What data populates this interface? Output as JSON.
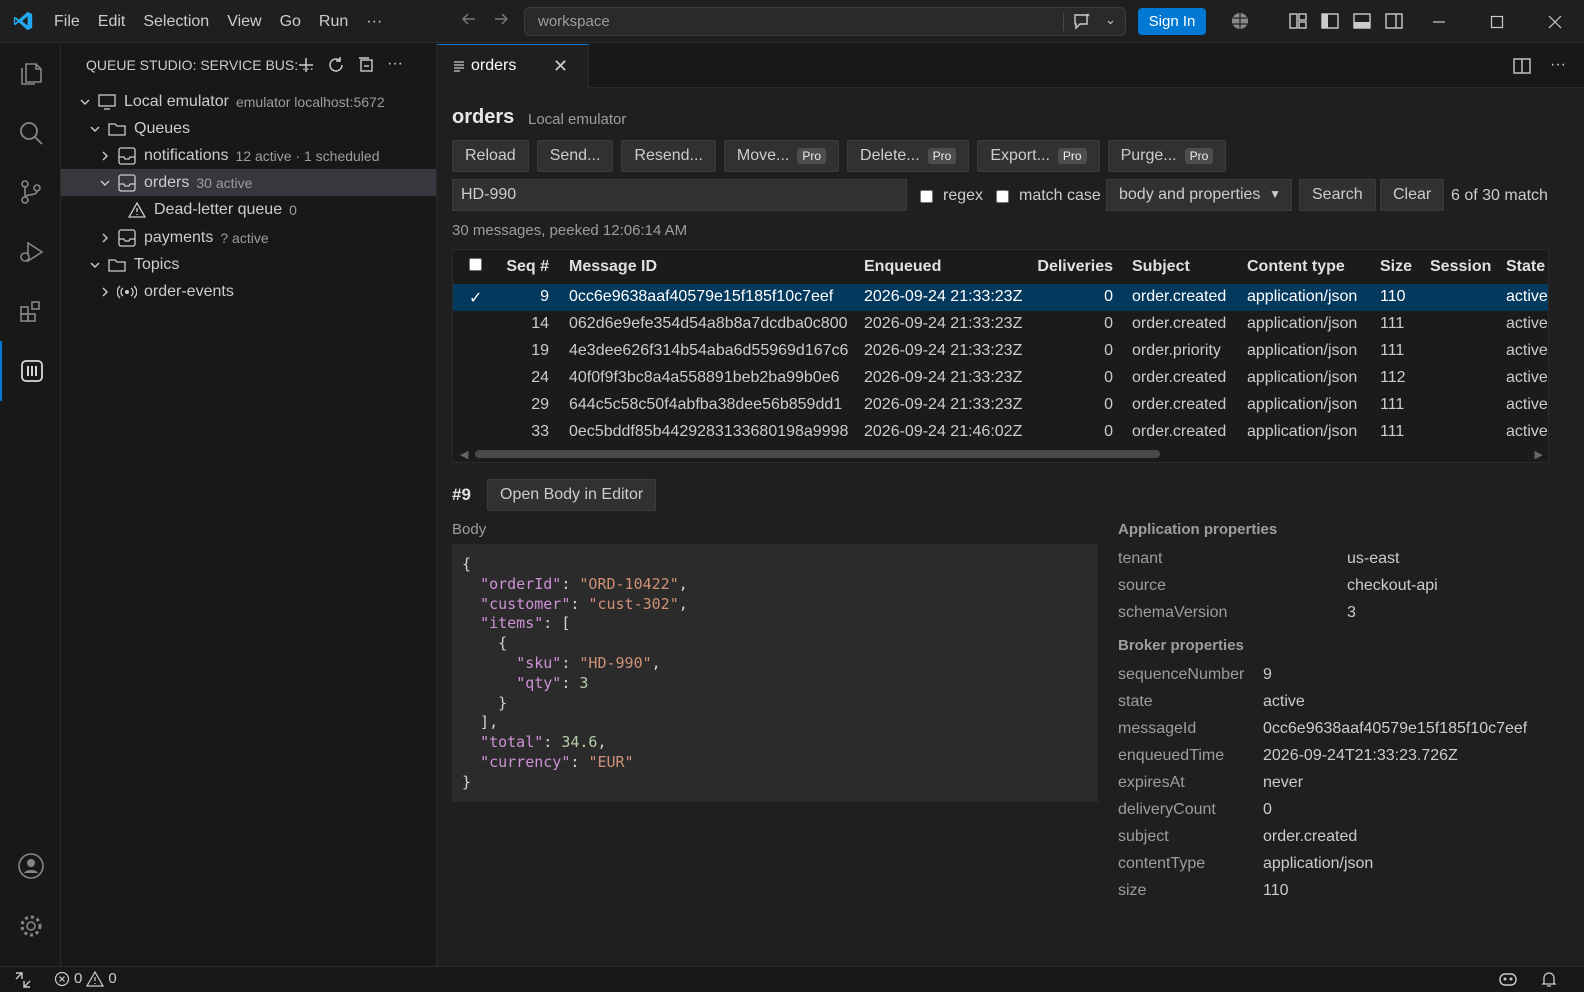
{
  "menu": {
    "items": [
      "File",
      "Edit",
      "Selection",
      "View",
      "Go",
      "Run",
      "···"
    ]
  },
  "command_center": {
    "text": "workspace"
  },
  "titlebar": {
    "sign_in": "Sign In"
  },
  "sidebar": {
    "header": "QUEUE STUDIO: SERVICE BUS: ...",
    "tree": {
      "emulator": {
        "label": "Local emulator",
        "detail": "emulator localhost:5672"
      },
      "queues": {
        "label": "Queues"
      },
      "notifications": {
        "label": "notifications",
        "detail": "12 active · 1 scheduled"
      },
      "orders": {
        "label": "orders",
        "detail": "30 active"
      },
      "dlq": {
        "label": "Dead-letter queue",
        "detail": "0"
      },
      "payments": {
        "label": "payments",
        "detail": "? active"
      },
      "topics": {
        "label": "Topics"
      },
      "order_events": {
        "label": "order-events"
      }
    }
  },
  "tab": {
    "label": "orders"
  },
  "page": {
    "title": "orders",
    "subtitle": "Local emulator",
    "buttons": {
      "reload": "Reload",
      "send": "Send...",
      "resend": "Resend...",
      "move": "Move...",
      "delete": "Delete...",
      "export": "Export...",
      "purge": "Purge..."
    },
    "pro_badge": "Pro",
    "search": {
      "value": "HD-990",
      "regex": "regex",
      "match_case": "match case",
      "scope": "body and properties",
      "search_btn": "Search",
      "clear_btn": "Clear",
      "match_info": "6 of 30 match"
    },
    "summary": "30 messages, peeked 12:06:14 AM"
  },
  "grid": {
    "columns": [
      "Seq #",
      "Message ID",
      "Enqueued",
      "Deliveries",
      "Subject",
      "Content type",
      "Size",
      "Session",
      "State"
    ],
    "check_mark": "✓",
    "rows": [
      {
        "seq": "9",
        "id": "0cc6e9638aaf40579e15f185f10c7eef",
        "enq": "2026-09-24 21:33:23Z",
        "del": "0",
        "sub": "order.created",
        "ct": "application/json",
        "size": "110",
        "session": "",
        "state": "active"
      },
      {
        "seq": "14",
        "id": "062d6e9efe354d54a8b8a7dcdba0c800",
        "enq": "2026-09-24 21:33:23Z",
        "del": "0",
        "sub": "order.created",
        "ct": "application/json",
        "size": "111",
        "session": "",
        "state": "active"
      },
      {
        "seq": "19",
        "id": "4e3dee626f314b54aba6d55969d167c6",
        "enq": "2026-09-24 21:33:23Z",
        "del": "0",
        "sub": "order.priority",
        "ct": "application/json",
        "size": "111",
        "session": "",
        "state": "active"
      },
      {
        "seq": "24",
        "id": "40f0f9f3bc8a4a558891beb2ba99b0e6",
        "enq": "2026-09-24 21:33:23Z",
        "del": "0",
        "sub": "order.created",
        "ct": "application/json",
        "size": "112",
        "session": "",
        "state": "active"
      },
      {
        "seq": "29",
        "id": "644c5c58c50f4abfba38dee56b859dd1",
        "enq": "2026-09-24 21:33:23Z",
        "del": "0",
        "sub": "order.created",
        "ct": "application/json",
        "size": "111",
        "session": "",
        "state": "active"
      },
      {
        "seq": "33",
        "id": "0ec5bddf85b4429283133680198a9998",
        "enq": "2026-09-24 21:46:02Z",
        "del": "0",
        "sub": "order.created",
        "ct": "application/json",
        "size": "111",
        "session": "",
        "state": "active"
      }
    ]
  },
  "detail": {
    "number": "#9",
    "open_body": "Open Body in Editor",
    "body_label": "Body",
    "body_lines": [
      [
        {
          "t": "{",
          "c": ""
        }
      ],
      [
        {
          "t": "  ",
          "c": ""
        },
        {
          "t": "\"orderId\"",
          "c": "k"
        },
        {
          "t": ": ",
          "c": ""
        },
        {
          "t": "\"ORD-10422\"",
          "c": "s"
        },
        {
          "t": ",",
          "c": ""
        }
      ],
      [
        {
          "t": "  ",
          "c": ""
        },
        {
          "t": "\"customer\"",
          "c": "k"
        },
        {
          "t": ": ",
          "c": ""
        },
        {
          "t": "\"cust-302\"",
          "c": "s"
        },
        {
          "t": ",",
          "c": ""
        }
      ],
      [
        {
          "t": "  ",
          "c": ""
        },
        {
          "t": "\"items\"",
          "c": "k"
        },
        {
          "t": ": [",
          "c": ""
        }
      ],
      [
        {
          "t": "    {",
          "c": ""
        }
      ],
      [
        {
          "t": "      ",
          "c": ""
        },
        {
          "t": "\"sku\"",
          "c": "k"
        },
        {
          "t": ": ",
          "c": ""
        },
        {
          "t": "\"HD-990\"",
          "c": "s"
        },
        {
          "t": ",",
          "c": ""
        }
      ],
      [
        {
          "t": "      ",
          "c": ""
        },
        {
          "t": "\"qty\"",
          "c": "k"
        },
        {
          "t": ": ",
          "c": ""
        },
        {
          "t": "3",
          "c": "n"
        }
      ],
      [
        {
          "t": "    }",
          "c": ""
        }
      ],
      [
        {
          "t": "  ],",
          "c": ""
        }
      ],
      [
        {
          "t": "  ",
          "c": ""
        },
        {
          "t": "\"total\"",
          "c": "k"
        },
        {
          "t": ": ",
          "c": ""
        },
        {
          "t": "34.6",
          "c": "n"
        },
        {
          "t": ",",
          "c": ""
        }
      ],
      [
        {
          "t": "  ",
          "c": ""
        },
        {
          "t": "\"currency\"",
          "c": "k"
        },
        {
          "t": ": ",
          "c": ""
        },
        {
          "t": "\"EUR\"",
          "c": "s"
        }
      ],
      [
        {
          "t": "}",
          "c": ""
        }
      ]
    ],
    "app_props_label": "Application properties",
    "app_props": [
      {
        "k": "tenant",
        "v": "us-east"
      },
      {
        "k": "source",
        "v": "checkout-api"
      },
      {
        "k": "schemaVersion",
        "v": "3"
      }
    ],
    "broker_props_label": "Broker properties",
    "broker_props": [
      {
        "k": "sequenceNumber",
        "v": "9"
      },
      {
        "k": "state",
        "v": "active"
      },
      {
        "k": "messageId",
        "v": "0cc6e9638aaf40579e15f185f10c7eef"
      },
      {
        "k": "enqueuedTime",
        "v": "2026-09-24T21:33:23.726Z"
      },
      {
        "k": "expiresAt",
        "v": "never"
      },
      {
        "k": "deliveryCount",
        "v": "0"
      },
      {
        "k": "subject",
        "v": "order.created"
      },
      {
        "k": "contentType",
        "v": "application/json"
      },
      {
        "k": "size",
        "v": "110"
      }
    ]
  },
  "statusbar": {
    "errors": "0",
    "warnings": "0"
  },
  "colors": {
    "accent": "#0078d4",
    "selection": "#04395e",
    "json_key": "#ce92d6",
    "json_string": "#ce9178",
    "json_number": "#b5cea8"
  }
}
